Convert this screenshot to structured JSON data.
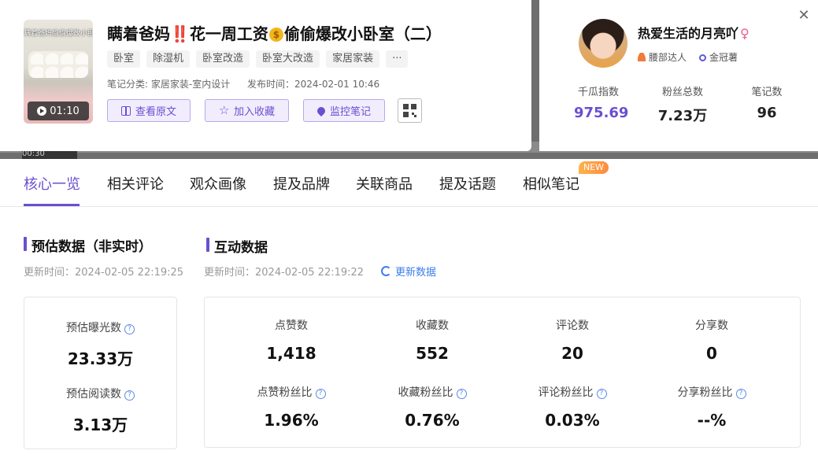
{
  "note": {
    "thumbnail_caption": "瞒着爸妈偷偷爆改小卧室",
    "duration": "01:10",
    "title_before": "瞒着爸妈‼️花一周工资",
    "title_icon": "money-bag-icon",
    "title_after": "偷偷爆改小卧室（二）",
    "tags": [
      "卧室",
      "除湿机",
      "卧室改造",
      "卧室大改造",
      "家居家装",
      "···"
    ],
    "category": "笔记分类: 家居家装-室内设计",
    "publish_time": "发布时间：2024-02-01 10:46",
    "actions": {
      "view_original": "查看原文",
      "add_favorite": "加入收藏",
      "monitor": "监控笔记"
    }
  },
  "author": {
    "name": "热爱生活的月亮吖",
    "gender_symbol": "♀",
    "badges": [
      "腰部达人",
      "金冠薯"
    ],
    "stats": [
      {
        "label": "千瓜指数",
        "value": "975.69"
      },
      {
        "label": "粉丝总数",
        "value": "7.23万"
      },
      {
        "label": "笔记数",
        "value": "96"
      }
    ]
  },
  "background_video_time": "00:30",
  "tabs": [
    "核心一览",
    "相关评论",
    "观众画像",
    "提及品牌",
    "关联商品",
    "提及话题",
    "相似笔记"
  ],
  "active_tab": "核心一览",
  "new_badge": "NEW",
  "estimate": {
    "title": "预估数据（非实时）",
    "updated": "更新时间：2024-02-05 22:19:25",
    "items": [
      {
        "label": "预估曝光数",
        "value": "23.33万"
      },
      {
        "label": "预估阅读数",
        "value": "3.13万"
      }
    ]
  },
  "interaction": {
    "title": "互动数据",
    "updated": "更新时间：2024-02-05 22:19:22",
    "refresh": "更新数据",
    "row1": [
      {
        "label": "点赞数",
        "value": "1,418"
      },
      {
        "label": "收藏数",
        "value": "552"
      },
      {
        "label": "评论数",
        "value": "20"
      },
      {
        "label": "分享数",
        "value": "0"
      }
    ],
    "row2": [
      {
        "label": "点赞粉丝比",
        "value": "1.96%"
      },
      {
        "label": "收藏粉丝比",
        "value": "0.76%"
      },
      {
        "label": "评论粉丝比",
        "value": "0.03%"
      },
      {
        "label": "分享粉丝比",
        "value": "--%"
      }
    ]
  },
  "colors": {
    "accent": "#6a4fd0",
    "link": "#3d7ee8",
    "female": "#ec5d85",
    "new_badge": "#ff9a40"
  }
}
